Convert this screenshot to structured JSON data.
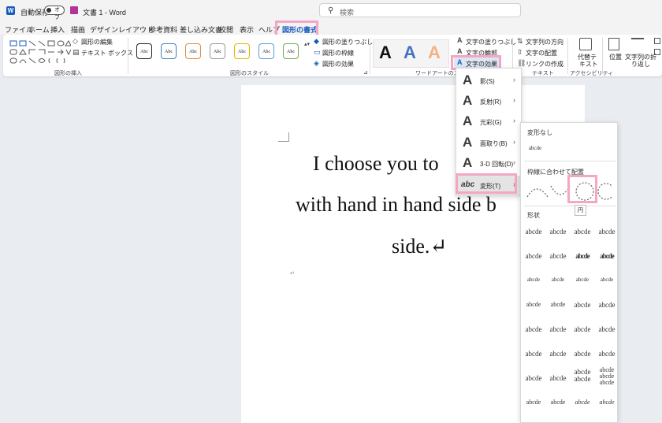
{
  "titlebar": {
    "app_logo": "W",
    "autosave_label": "自動保存",
    "autosave_state": "オフ",
    "save_icon": "save-icon",
    "doc_title": "文書 1 - Word",
    "search_placeholder": "検索"
  },
  "tabs": [
    "ファイル",
    "ホーム",
    "挿入",
    "描画",
    "デザイン",
    "レイアウト",
    "参考資料",
    "差し込み文書",
    "校閲",
    "表示",
    "ヘルプ",
    "図形の書式"
  ],
  "ribbon": {
    "shape_insert": {
      "edit_shape": "図形の編集",
      "text_box": "テキスト ボックス",
      "group": "図形の挿入"
    },
    "shape_styles": {
      "swatch": "Abc",
      "fill": "図形の塗りつぶし",
      "outline": "図形の枠線",
      "effects": "図形の効果",
      "group": "図形のスタイル"
    },
    "wordart": {
      "letter": "A",
      "text_fill": "文字の塗りつぶし",
      "text_outline": "文字の輪郭",
      "text_effects": "文字の効果",
      "group": "ワードアートのスタイル"
    },
    "text": {
      "direction": "文字列の方向",
      "align": "文字の配置",
      "link": "リンクの作成",
      "group": "テキスト"
    },
    "accessibility": {
      "alt_text_1": "代替テ",
      "alt_text_2": "キスト",
      "group": "アクセシビリティ"
    },
    "arrange": {
      "position": "位置",
      "wrap_1": "文字列の折",
      "wrap_2": "り返し"
    }
  },
  "document": {
    "line1": "I choose you to",
    "line2": "with hand in hand side b",
    "line3": "side.↵",
    "small_mark": "↵"
  },
  "effects_menu": {
    "items": [
      {
        "label": "影(S)"
      },
      {
        "label": "反射(R)"
      },
      {
        "label": "光彩(G)"
      },
      {
        "label": "面取り(B)"
      },
      {
        "label": "3-D 回転(D)"
      },
      {
        "label": "変形(T)"
      }
    ],
    "icon_letter": "A",
    "transform_icon": "abc"
  },
  "transform_panel": {
    "no_transform_header": "変形なし",
    "no_transform_sample": "abcde",
    "follow_path_header": "枠線に合わせて配置",
    "shape_header": "形状",
    "sample": "abcde",
    "tooltip": "円"
  }
}
